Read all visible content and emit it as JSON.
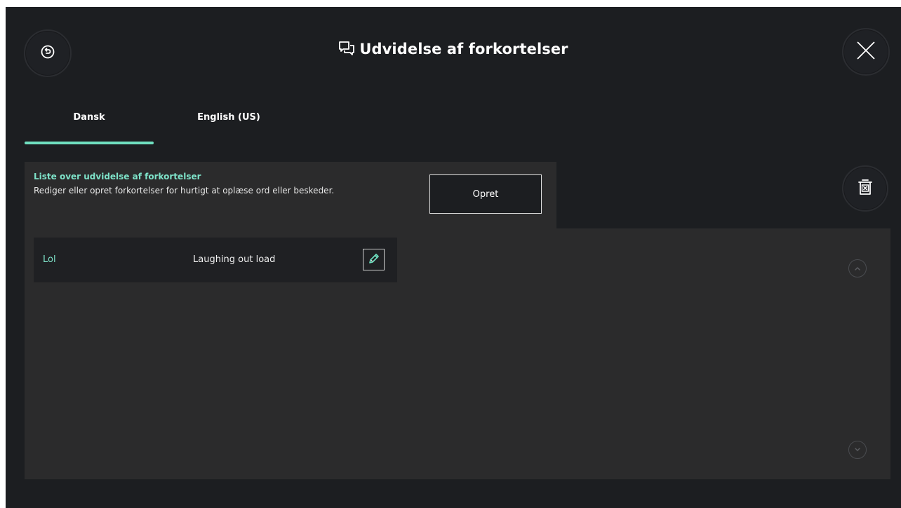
{
  "header": {
    "title": "Udvidelse af forkortelser",
    "back_icon": "back-history-icon",
    "close_icon": "close-icon",
    "title_icon": "chat-bubbles-icon"
  },
  "tabs": [
    {
      "label": "Dansk",
      "active": true
    },
    {
      "label": "English (US)",
      "active": false
    }
  ],
  "list": {
    "title": "Liste over udvidelse af forkortelser",
    "description": "Rediger eller opret forkortelser for hurtigt at oplæse ord eller beskeder.",
    "create_label": "Opret",
    "items": [
      {
        "abbreviation": "Lol",
        "expansion": "Laughing out load"
      }
    ]
  },
  "colors": {
    "accent": "#6fe0c0",
    "background": "#1c1e21",
    "panel": "#2b2b2c"
  }
}
